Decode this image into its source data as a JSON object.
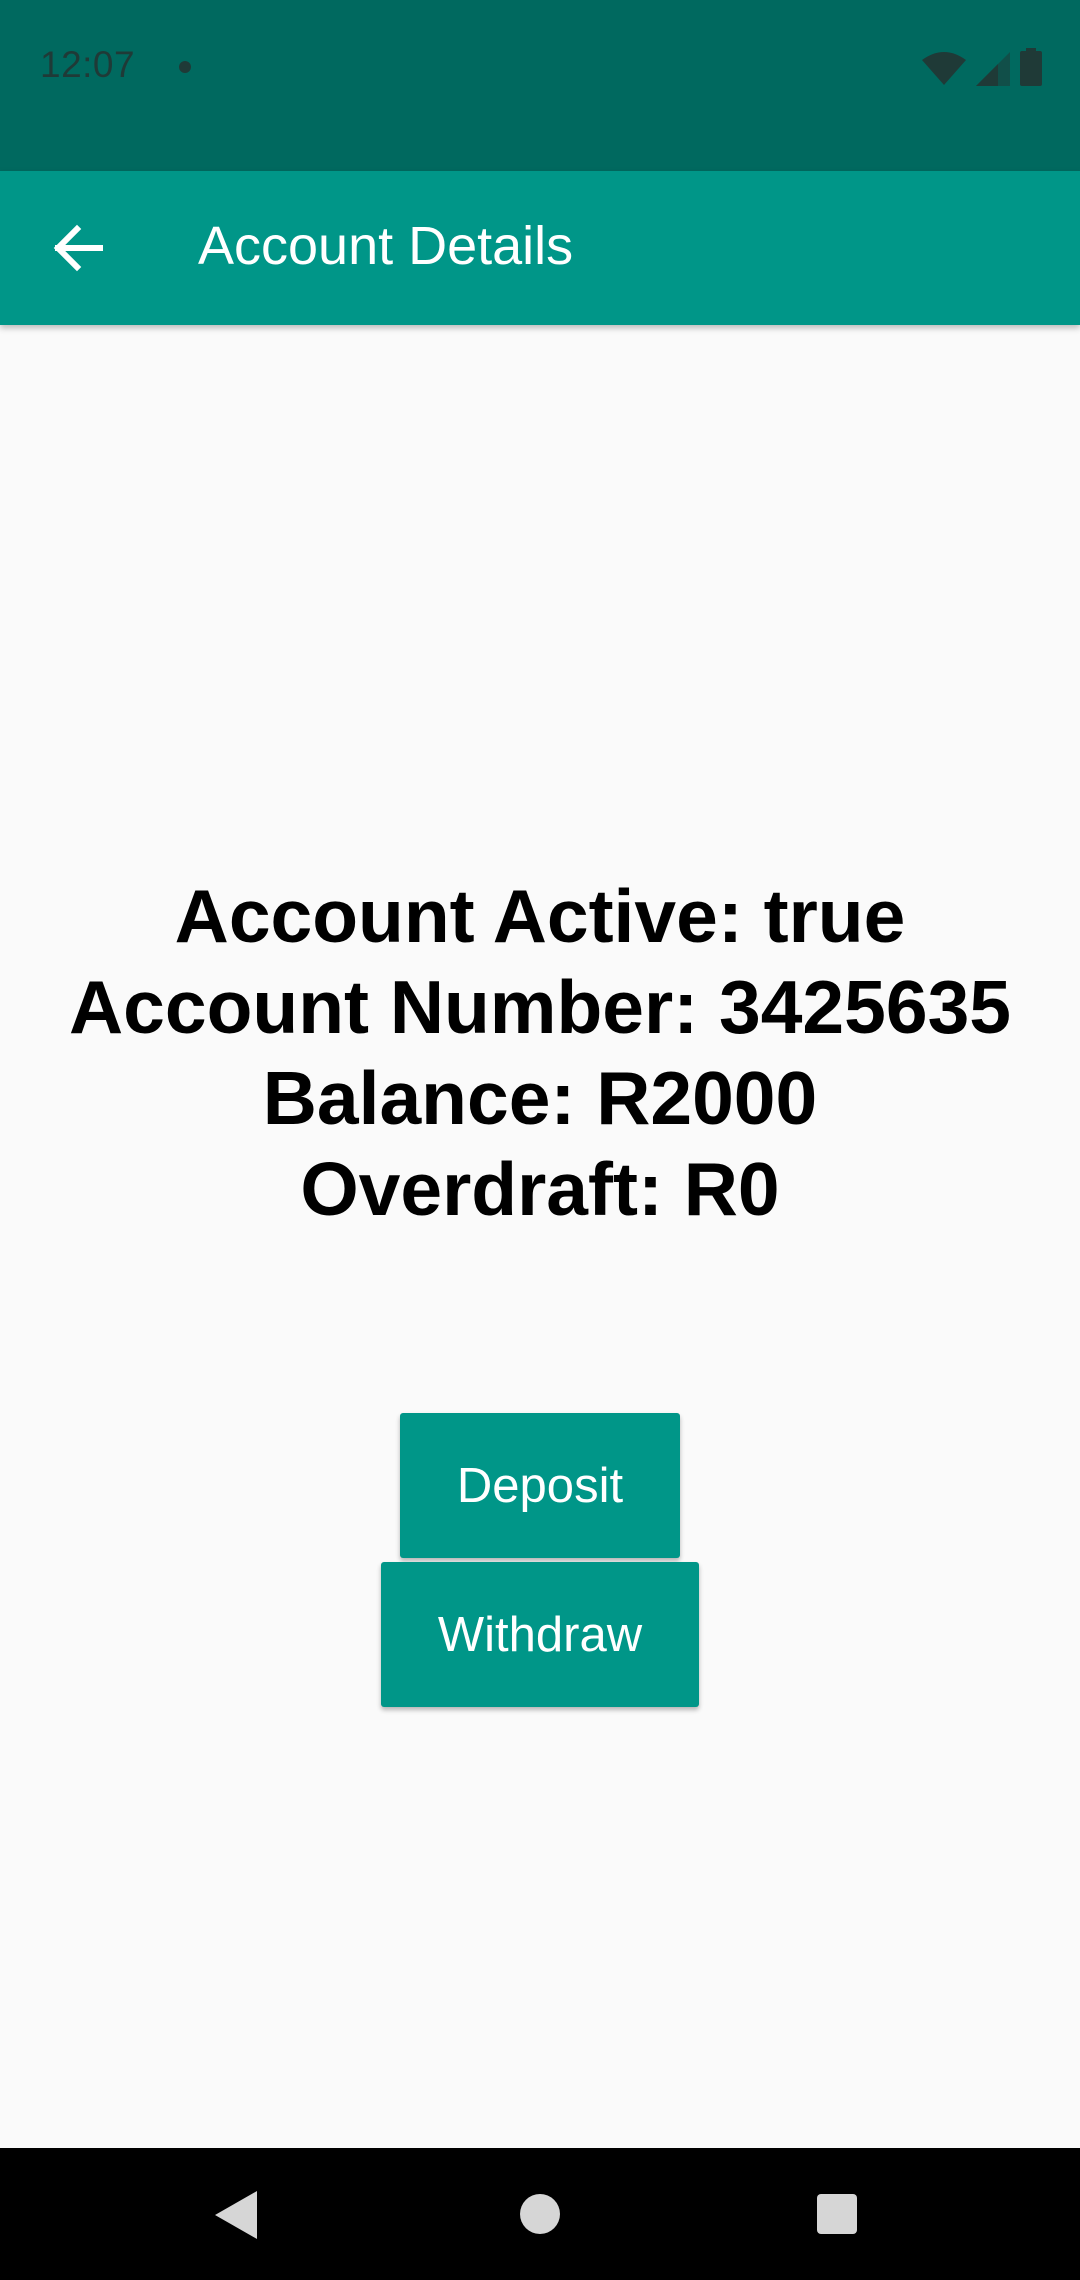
{
  "status_bar": {
    "time": "12:07",
    "icons": [
      "notification-dot-icon",
      "wifi-icon",
      "cellular-signal-icon",
      "battery-icon"
    ]
  },
  "app_bar": {
    "title": "Account Details",
    "back_icon": "arrow-back-icon"
  },
  "account": {
    "active_line": "Account Active: true",
    "number_line": "Account Number: 3425635",
    "balance_line": "Balance: R2000",
    "overdraft_line": "Overdraft: R0"
  },
  "actions": {
    "deposit_label": "Deposit",
    "withdraw_label": "Withdraw"
  },
  "nav_bar": {
    "icons": [
      "back-triangle-icon",
      "home-circle-icon",
      "recents-square-icon"
    ]
  },
  "colors": {
    "status_bar": "#00695f",
    "primary": "#009688",
    "background": "#fafafa",
    "text": "#000000"
  }
}
